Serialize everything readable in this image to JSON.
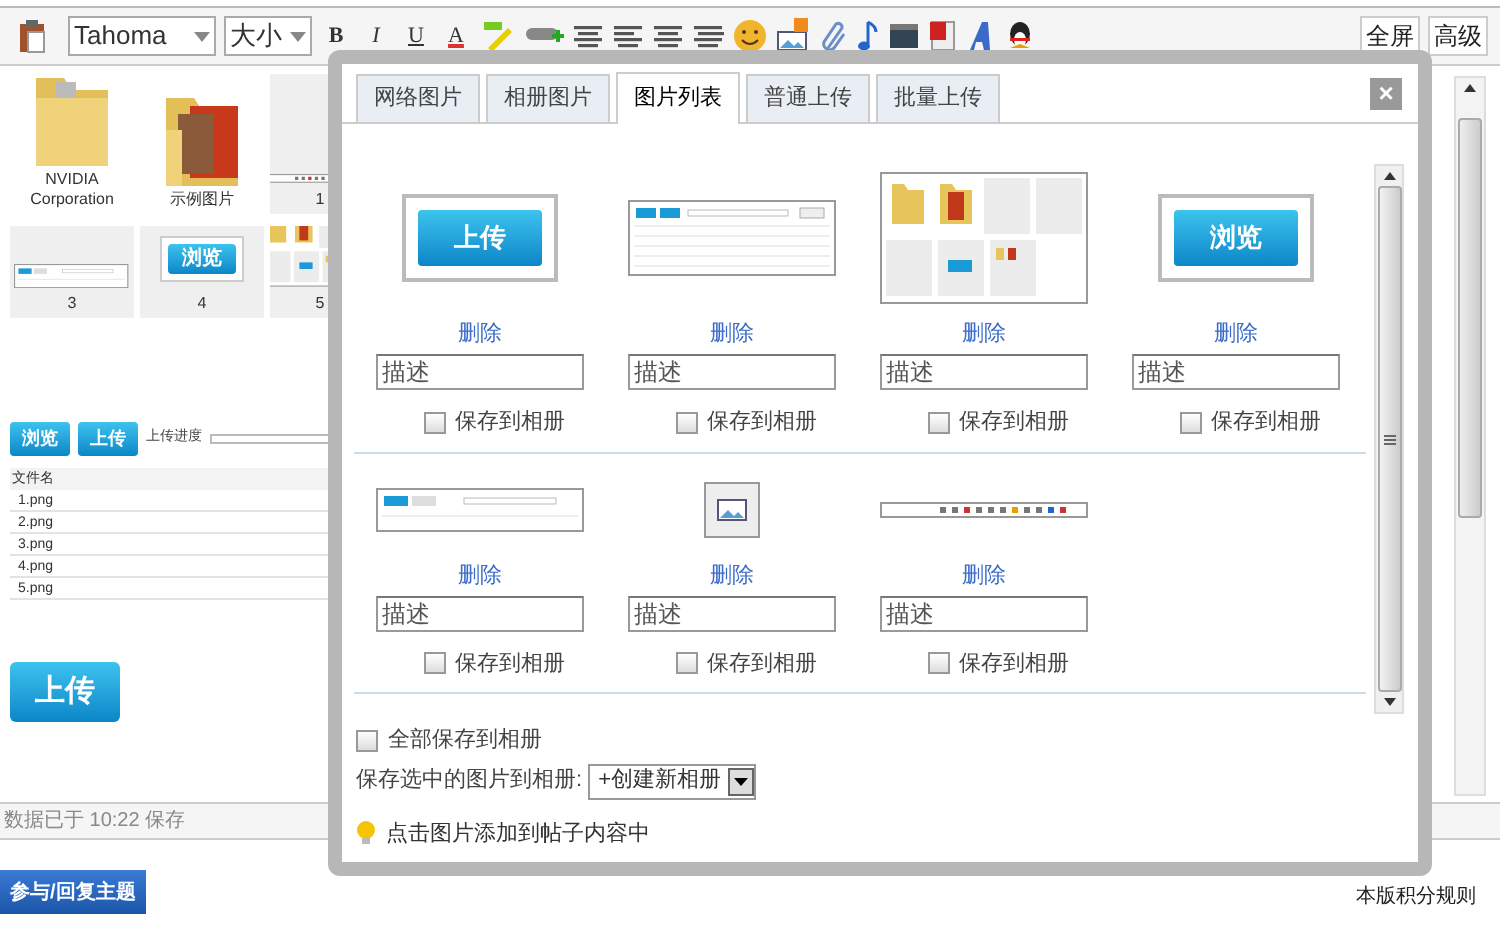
{
  "toolbar": {
    "font": "Tahoma",
    "size": "大小",
    "format_buttons": [
      "B",
      "I",
      "U",
      "A"
    ],
    "right_buttons": [
      "全屏",
      "高级"
    ]
  },
  "tiles": [
    {
      "kind": "folder",
      "label": "NVIDIA Corporation"
    },
    {
      "kind": "photo-folder",
      "label": "示例图片"
    },
    {
      "kind": "strip",
      "label": "1"
    },
    {
      "kind": "upload-bar",
      "label": "3"
    },
    {
      "kind": "button",
      "label": "4",
      "button": "浏览"
    },
    {
      "kind": "grid",
      "label": "5"
    }
  ],
  "uploader": {
    "buttons": [
      "浏览",
      "上传"
    ],
    "progress_label": "上传进度",
    "progress": {
      "level": 0
    },
    "file_header": "文件名",
    "files": [
      "1.png",
      "2.png",
      "3.png",
      "4.png",
      "5.png"
    ]
  },
  "upload_button": "上传",
  "autosave": "数据已于 10:22 保存",
  "reply_button": "参与/回复主题",
  "footer_link": "本版积分规则",
  "dialog": {
    "tabs": [
      {
        "label": "网络图片",
        "selected": false
      },
      {
        "label": "相册图片",
        "selected": false
      },
      {
        "label": "图片列表",
        "selected": true
      },
      {
        "label": "普通上传",
        "selected": false
      },
      {
        "label": "批量上传",
        "selected": false
      }
    ],
    "close": "×",
    "image_rows": [
      [
        {
          "kind": "button",
          "button": "上传",
          "delete": "删除",
          "placeholder": "描述",
          "save_label": "保存到相册",
          "checked": false
        },
        {
          "kind": "table",
          "delete": "删除",
          "placeholder": "描述",
          "save_label": "保存到相册",
          "checked": false
        },
        {
          "kind": "grid",
          "delete": "删除",
          "placeholder": "描述",
          "save_label": "保存到相册",
          "checked": false
        },
        {
          "kind": "button",
          "button": "浏览",
          "delete": "删除",
          "placeholder": "描述",
          "save_label": "保存到相册",
          "checked": false
        }
      ],
      [
        {
          "kind": "upload-bar",
          "delete": "删除",
          "placeholder": "描述",
          "save_label": "保存到相册",
          "checked": false
        },
        {
          "kind": "icon",
          "delete": "删除",
          "placeholder": "描述",
          "save_label": "保存到相册",
          "checked": false
        },
        {
          "kind": "strip",
          "delete": "删除",
          "placeholder": "描述",
          "save_label": "保存到相册",
          "checked": false
        }
      ]
    ],
    "save_all": {
      "label": "全部保存到相册",
      "checked": false
    },
    "album_label": "保存选中的图片到相册:",
    "album_select": "+创建新相册",
    "hint": "点击图片添加到帖子内容中"
  }
}
